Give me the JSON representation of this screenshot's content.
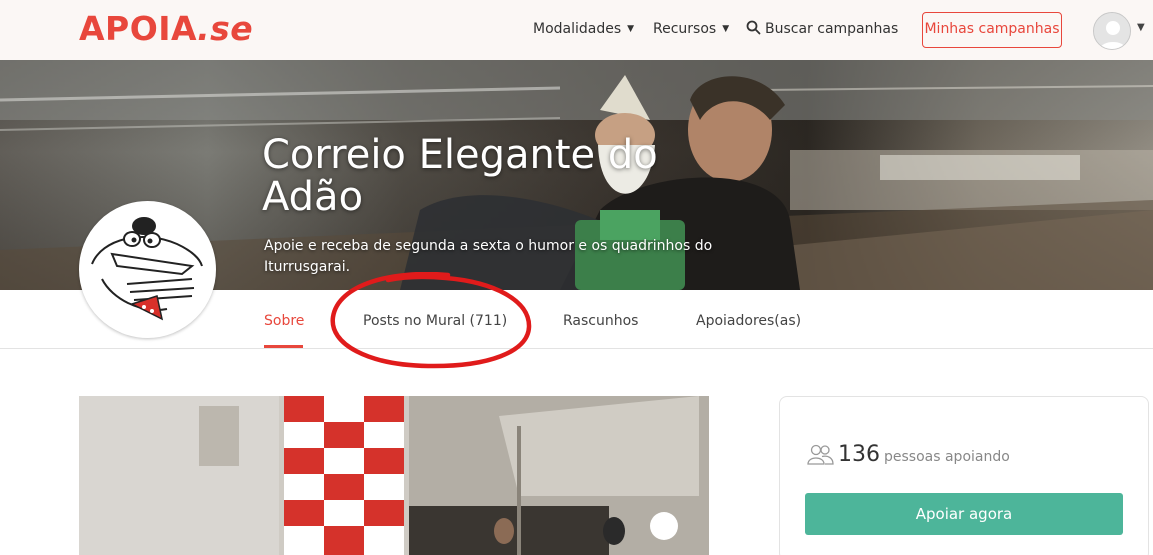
{
  "header": {
    "logo_main": "APOIA",
    "logo_suffix": ".se",
    "nav_modalidades": "Modalidades",
    "nav_recursos": "Recursos",
    "search_label": "Buscar campanhas",
    "minhas_campanhas": "Minhas campanhas"
  },
  "hero": {
    "title": "Correio Elegante do Adão",
    "subtitle": "Apoie e receba de segunda a sexta o humor e os quadrinhos do Iturrusgarai."
  },
  "tabs": [
    {
      "label": "Sobre",
      "active": true
    },
    {
      "label": "Posts no Mural (711)",
      "active": false
    },
    {
      "label": "Rascunhos",
      "active": false
    },
    {
      "label": "Apoiadores(as)",
      "active": false
    }
  ],
  "support": {
    "count": "136",
    "label": "pessoas apoiando",
    "button": "Apoiar agora"
  },
  "colors": {
    "brand": "#e8473c",
    "support_button": "#4db59a",
    "annotation": "#e01b1b"
  },
  "icons": {
    "nav_caret": "caret-down-icon",
    "search": "search-icon",
    "user": "user-avatar-icon",
    "supporters": "people-icon"
  }
}
